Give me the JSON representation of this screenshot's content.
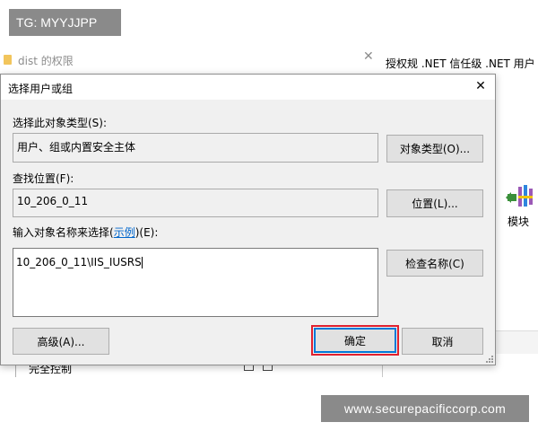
{
  "watermark_top": "TG: MYYJJPP",
  "watermark_bottom": "www.securepacificcorp.com",
  "background_window": {
    "title": "dist 的权限",
    "close_glyph": "✕",
    "bottom_text": "完全控制"
  },
  "iis_background": {
    "header_text": "授权规 .NET 信任级  .NET 用户",
    "module_label": "模块",
    "module_icon": "modules-icon"
  },
  "dialog": {
    "title": "选择用户或组",
    "close_glyph": "✕",
    "object_type_label": "选择此对象类型(S):",
    "object_type_value": "用户、组或内置安全主体",
    "object_type_button": "对象类型(O)...",
    "location_label": "查找位置(F):",
    "location_value": "10_206_0_11",
    "location_button": "位置(L)...",
    "names_label_prefix": "输入对象名称来选择(",
    "names_label_link": "示例",
    "names_label_suffix": ")(E):",
    "names_value": "10_206_0_11\\IIS_IUSRS",
    "check_names_button": "检查名称(C)",
    "advanced_button": "高级(A)...",
    "ok_button": "确定",
    "cancel_button": "取消"
  },
  "colors": {
    "dialog_bg": "#f0f0f0",
    "default_button_border": "#0078d7",
    "highlight_outline": "#e0212f",
    "link": "#0066cc"
  }
}
